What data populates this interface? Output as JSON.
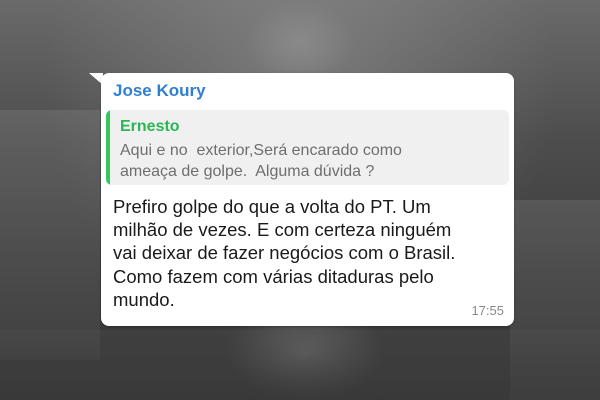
{
  "message": {
    "sender_name": "Jose Koury",
    "sender_color": "#2f7fd3",
    "quoted": {
      "author": "Ernesto",
      "author_color": "#2bb655",
      "lines": [
        "Aqui e no  exterior,Será encarado como",
        "ameaça de golpe.  Alguma dúvida ?"
      ]
    },
    "body_lines": [
      "Prefiro golpe do que a volta do PT. Um",
      "milhão de vezes. E com certeza ninguém",
      "vai deixar de fazer negócios com o Brasil.",
      "Como fazem com várias ditaduras pelo",
      "mundo."
    ],
    "time": "17:55"
  }
}
